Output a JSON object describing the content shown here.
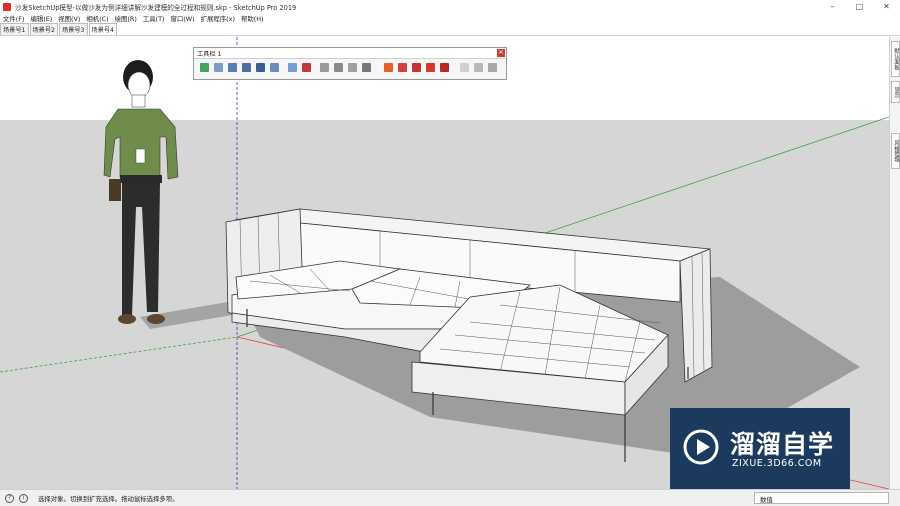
{
  "window": {
    "title": "沙发SketchUp模型-以做沙发为例详细讲解沙发建模的全过程和规则.skp - SketchUp Pro 2019",
    "controls": [
      "–",
      "□",
      "✕"
    ]
  },
  "menu": {
    "items": [
      "文件(F)",
      "编辑(E)",
      "视图(V)",
      "相机(C)",
      "绘图(R)",
      "工具(T)",
      "窗口(W)",
      "扩展程序(x)",
      "帮助(H)"
    ]
  },
  "scenes": {
    "tabs": [
      "场景号1",
      "场景号2",
      "场景号3",
      "场景号4"
    ],
    "active_index": 3
  },
  "toolbar": {
    "title": "工具栏 1",
    "close": "✕",
    "icons": [
      "select-icon",
      "eraser-icon",
      "line-icon",
      "rectangle-icon",
      "circle-icon",
      "arc-icon",
      "polygon-icon",
      "freehand-icon",
      "orbit-icon",
      "pan-icon",
      "zoom-icon",
      "zoom-extents-icon",
      "paint-icon",
      "sun-icon",
      "components-icon",
      "warehouse-icon",
      "extension-icon",
      "camera-icon",
      "move-icon",
      "rotate-icon",
      "scale-icon"
    ]
  },
  "right_tray": {
    "tabs": [
      "默认面板",
      "显示",
      "风格管理"
    ]
  },
  "statusbar": {
    "info_icon": "i",
    "help_icon": "?",
    "message": "选择对象。切换到扩充选择。拖动鼠标选择多项。",
    "measurement_label": "数值"
  },
  "watermark": {
    "title": "溜溜自学",
    "subtitle": "ZIXUE.3D66.COM"
  },
  "colors": {
    "sky": "#ffffff",
    "ground": "#d6d6d6",
    "shadow": "#9b9b9b",
    "sofa": "#f7f7f7",
    "axis_red": "#d44",
    "axis_green": "#3a3",
    "axis_blue": "#33c",
    "watermark_bg": "#1c3a5e"
  }
}
